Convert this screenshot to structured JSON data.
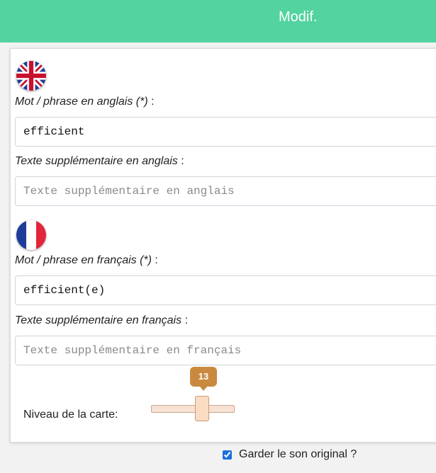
{
  "header": {
    "title": "Modif."
  },
  "english": {
    "flag_icon": "uk-flag-icon",
    "word_label": "Mot / phrase en anglais (*)",
    "word_value": "efficient",
    "extra_label": "Texte supplémentaire en anglais",
    "extra_placeholder": "Texte supplémentaire en anglais"
  },
  "french": {
    "flag_icon": "france-flag-icon",
    "word_label": "Mot / phrase en français (*)",
    "word_value": "efficient(e)",
    "extra_label": "Texte supplémentaire en français",
    "extra_placeholder": "Texte supplémentaire en français"
  },
  "colon": ":",
  "level": {
    "label": "Niveau de la carte:",
    "value": "13"
  },
  "keep_sound": {
    "label": "Garder le son original ?",
    "checked": true
  },
  "colors": {
    "header_bg": "#52d3a0",
    "slider_tooltip": "#c98a3f",
    "checkbox": "#1a6fe0"
  }
}
